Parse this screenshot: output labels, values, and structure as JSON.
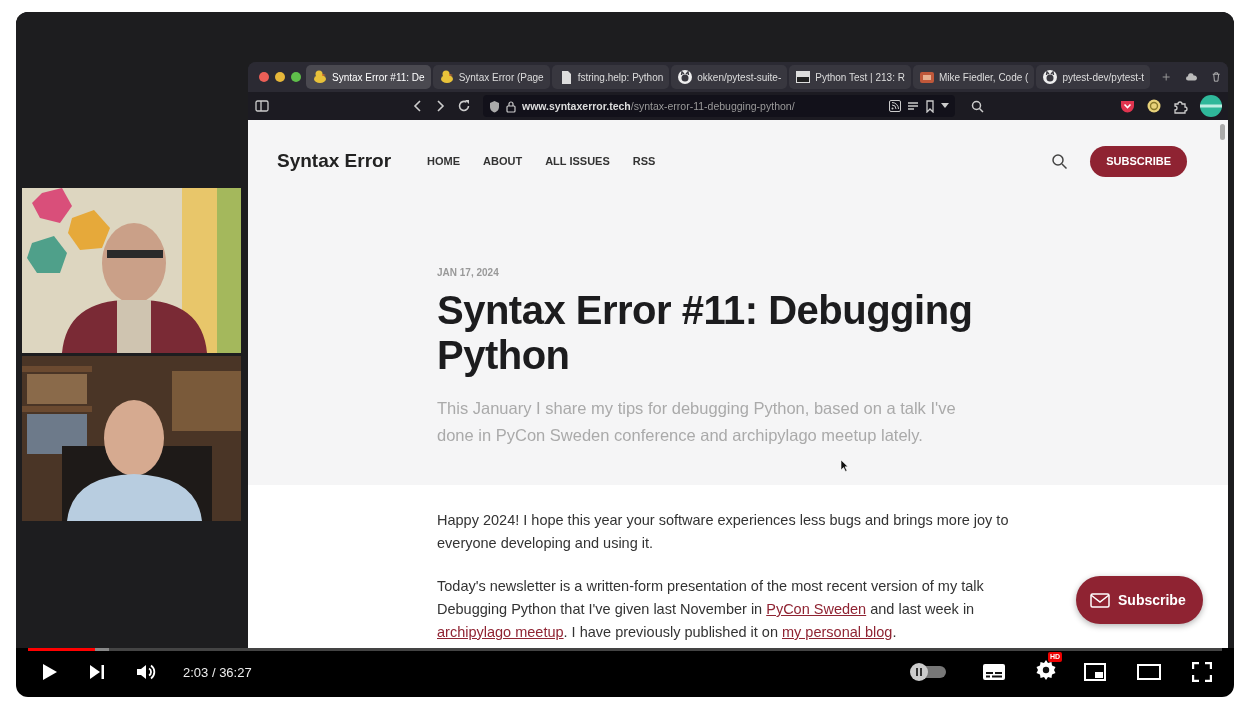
{
  "video": {
    "browser": {
      "tabs": [
        {
          "title": "Syntax Error #11: De",
          "kind": "duck",
          "selected": true
        },
        {
          "title": "Syntax Error (Page",
          "kind": "duck",
          "selected": false
        },
        {
          "title": "fstring.help: Python",
          "kind": "document",
          "selected": false
        },
        {
          "title": "okken/pytest-suite-",
          "kind": "github",
          "selected": false
        },
        {
          "title": "Python Test | 213: R",
          "kind": "thumbnail",
          "selected": false
        },
        {
          "title": "Mike Fiedler, Code (",
          "selected": false
        },
        {
          "title": "pytest-dev/pytest-t",
          "kind": "github",
          "selected": false
        }
      ],
      "url": {
        "domain": "www.syntaxerror.tech",
        "path": "/syntax-error-11-debugging-python/"
      },
      "site": {
        "logo": "Syntax Error",
        "nav": [
          "HOME",
          "ABOUT",
          "ALL ISSUES",
          "RSS"
        ],
        "subscribe": "SUBSCRIBE"
      },
      "article": {
        "date": "JAN 17, 2024",
        "title": "Syntax Error #11: Debugging Python",
        "subtitle": "This January I share my tips for debugging Python, based on a talk I've done in PyCon Sweden conference and archipylago meetup lately.",
        "paragraphs": [
          [
            {
              "text": "Happy 2024! I hope this year your software experiences less bugs and brings more joy to everyone developing and using it.",
              "link": false
            }
          ],
          [
            {
              "text": "Today's newsletter is a written-form presentation of the most recent version of my talk Debugging Python that I've given last November in ",
              "link": false
            },
            {
              "text": "PyCon Sweden",
              "link": true
            },
            {
              "text": " and last week in ",
              "link": false
            },
            {
              "text": "archipylago meetup",
              "link": true
            },
            {
              "text": ". I have previously published it on ",
              "link": false
            },
            {
              "text": "my personal blog",
              "link": true
            },
            {
              "text": ".",
              "link": false
            }
          ]
        ]
      },
      "floating_subscribe": "Subscribe"
    }
  },
  "controls": {
    "progress": {
      "level": 0.056
    },
    "buffer": {
      "level": 0.068
    },
    "time": "2:03 / 36:27",
    "autoplay": {
      "on": false
    },
    "quality_badge": "HD"
  }
}
